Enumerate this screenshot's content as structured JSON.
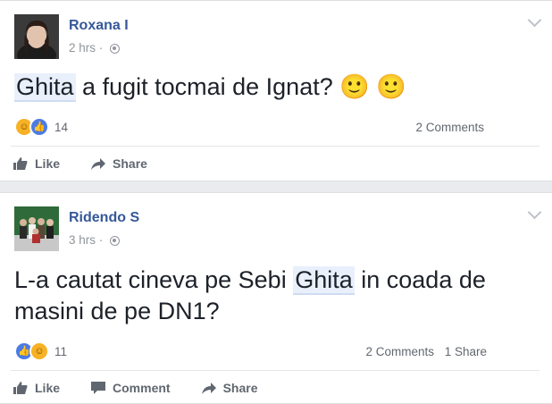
{
  "posts": [
    {
      "author": "Roxana I",
      "time": "2 hrs",
      "text_parts": [
        "Ghita",
        " a fugit tocmai de Ignat? ",
        "🙂",
        " ",
        "🙂"
      ],
      "reaction_count": "14",
      "comments": "2 Comments",
      "share_count": "",
      "actions": [
        "Like",
        "Share"
      ]
    },
    {
      "author": "Ridendo S",
      "time": "3 hrs",
      "text_parts": [
        "L-a cautat cineva pe Sebi ",
        "Ghita",
        " in coada de masini de pe DN1?"
      ],
      "reaction_count": "11",
      "comments": "2 Comments",
      "share_count": "1 Share",
      "actions": [
        "Like",
        "Comment",
        "Share"
      ]
    }
  ],
  "colors": {
    "author": "#365899",
    "meta": "#90949c",
    "highlight": "#e9f0fc",
    "like_blue": "#4b7be5",
    "haha_yellow": "#f7b125",
    "background": "#e9ebee"
  },
  "icons": [
    "globe-icon",
    "chevron-down-icon",
    "haha-reaction-icon",
    "like-reaction-icon",
    "thumbs-up-icon",
    "share-arrow-icon",
    "comment-bubble-icon"
  ]
}
